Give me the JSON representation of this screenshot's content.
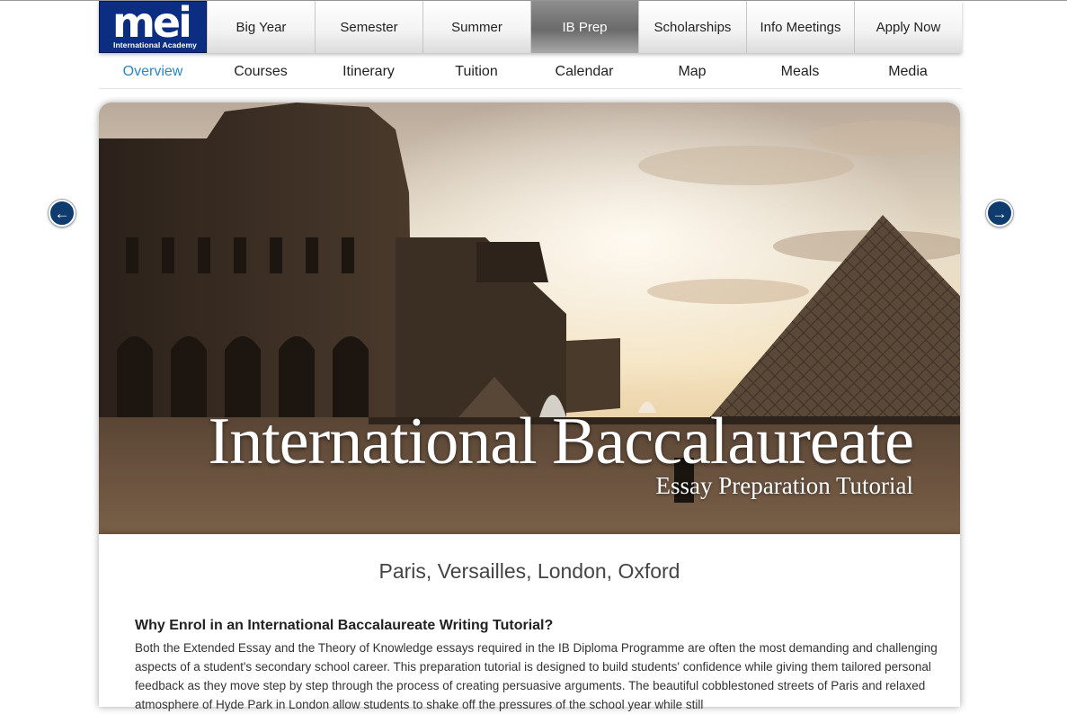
{
  "logo": {
    "mark": "mei",
    "subtitle": "International Academy"
  },
  "topnav": {
    "items": [
      {
        "label": "Big Year"
      },
      {
        "label": "Semester"
      },
      {
        "label": "Summer"
      },
      {
        "label": "IB Prep",
        "active": true
      },
      {
        "label": "Scholarships"
      },
      {
        "label": "Info Meetings"
      },
      {
        "label": "Apply Now"
      }
    ]
  },
  "subnav": {
    "items": [
      {
        "label": "Overview",
        "active": true
      },
      {
        "label": "Courses"
      },
      {
        "label": "Itinerary"
      },
      {
        "label": "Tuition"
      },
      {
        "label": "Calendar"
      },
      {
        "label": "Map"
      },
      {
        "label": "Meals"
      },
      {
        "label": "Media"
      }
    ]
  },
  "carousel": {
    "prev_icon": "arrow-left-circle-icon",
    "next_icon": "arrow-right-circle-icon"
  },
  "hero": {
    "title": "International Baccalaureate",
    "subtitle": "Essay Preparation Tutorial"
  },
  "content": {
    "locations": "Paris, Versailles, London, Oxford",
    "heading": "Why Enrol in an International Baccalaureate Writing Tutorial?",
    "body": "Both the Extended Essay and the Theory of Knowledge essays required in the IB Diploma Programme are often the most demanding and challenging aspects of a student's secondary school career. This preparation tutorial is designed to build students' confidence while giving them tailored personal feedback as they move step by step through the process of creating persuasive arguments. The beautiful cobblestoned streets of Paris and relaxed atmosphere of Hyde Park in London allow students to shake off the pressures of the school year while still"
  },
  "colors": {
    "brand_blue": "#0b2e83",
    "active_link": "#2a86c6",
    "arrow_blue": "#0f3c6f"
  }
}
